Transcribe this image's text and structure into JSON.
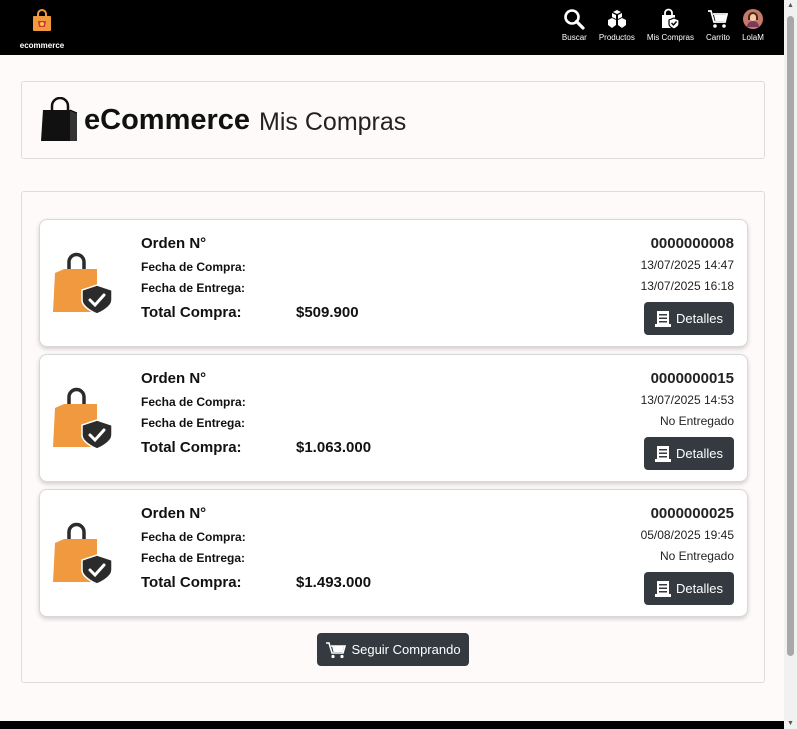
{
  "navbar": {
    "brand_label": "ecommerce",
    "items": [
      {
        "label": "Buscar",
        "icon": "search-icon"
      },
      {
        "label": "Productos",
        "icon": "boxes-icon"
      },
      {
        "label": "Mis Compras",
        "icon": "shopping-bag-shield-icon"
      },
      {
        "label": "Carrito",
        "icon": "cart-icon"
      },
      {
        "label": "LolaM",
        "icon": "user-avatar"
      }
    ]
  },
  "header": {
    "brand": "eCommerce",
    "section": "Mis Compras"
  },
  "orders": [
    {
      "title": "Orden N°",
      "fecha_label": "Fecha de Compra:",
      "entrega_label": "Fecha de Entrega:",
      "total_label": "Total Compra:",
      "number": "0000000008",
      "fecha": "13/07/2025 14:47",
      "entrega": "13/07/2025 16:18",
      "total": "$509.900",
      "button": "Detalles"
    },
    {
      "title": "Orden N°",
      "fecha_label": "Fecha de Compra:",
      "entrega_label": "Fecha de Entrega:",
      "total_label": "Total Compra:",
      "number": "0000000015",
      "fecha": "13/07/2025 14:53",
      "entrega": "No Entregado",
      "total": "$1.063.000",
      "button": "Detalles"
    },
    {
      "title": "Orden N°",
      "fecha_label": "Fecha de Compra:",
      "entrega_label": "Fecha de Entrega:",
      "total_label": "Total Compra:",
      "number": "0000000025",
      "fecha": "05/08/2025 19:45",
      "entrega": "No Entregado",
      "total": "$1.493.000",
      "button": "Detalles"
    }
  ],
  "actions": {
    "seguir_label": "Seguir Comprando"
  },
  "colors": {
    "navbar": "#000000",
    "button": "#343a40",
    "bag_orange": "#f0993e",
    "shield": "#2b2b2b",
    "page_bg": "#fffafa"
  }
}
